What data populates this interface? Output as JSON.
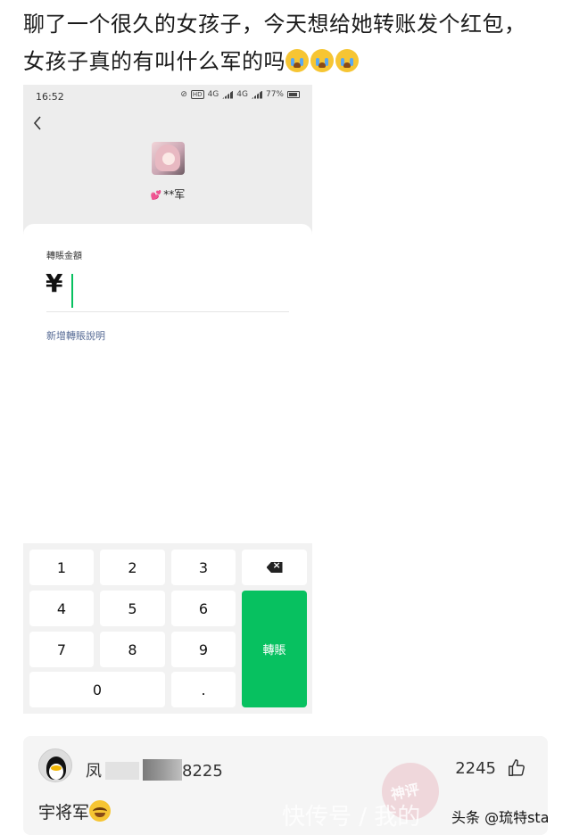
{
  "post": {
    "line1": "聊了一个很久的女孩子，今天想给她转账发个红包，",
    "line2": "女孩子真的有叫什么军的吗"
  },
  "phone": {
    "status": {
      "time": "16:52",
      "network": "4G",
      "battery": "77%"
    },
    "recipient_name": "**军",
    "amount_label": "轉賬金額",
    "currency_symbol": "¥",
    "add_note": "新增轉賬說明",
    "keys": [
      "1",
      "2",
      "3",
      "4",
      "5",
      "6",
      "7",
      "8",
      "9",
      "0",
      "."
    ],
    "transfer_label": "轉賬"
  },
  "comment": {
    "user_prefix": "凤",
    "user_suffix": "8225",
    "likes": "2245",
    "text": "宇将军",
    "stamp": "神评",
    "watermark": "快传号 / 我的",
    "source": "头条 @琉特star"
  },
  "icons": {
    "back": "chevron-left-icon",
    "delete": "backspace-icon",
    "like": "thumbs-up-icon"
  },
  "colors": {
    "accent_green": "#07c160",
    "link_blue": "#576b95"
  }
}
